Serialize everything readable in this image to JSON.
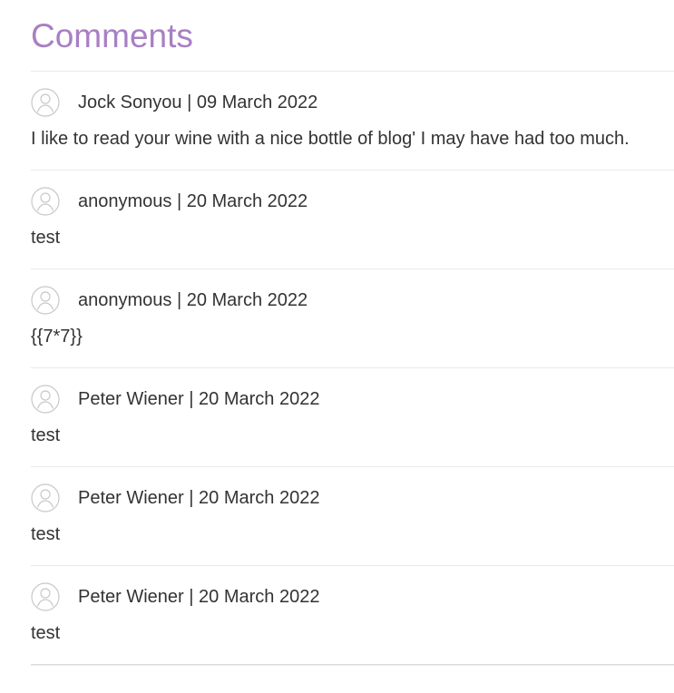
{
  "section": {
    "title": "Comments"
  },
  "comments": [
    {
      "author_line": "Jock Sonyou | 09 March 2022",
      "text": "I like to read your wine with a nice bottle of blog' I may have had too much.",
      "avatar_icon": "user-avatar-icon"
    },
    {
      "author_line": "anonymous | 20 March 2022",
      "text": "test",
      "avatar_icon": "user-avatar-icon"
    },
    {
      "author_line": "anonymous | 20 March 2022",
      "text": "{{7*7}}",
      "avatar_icon": "user-avatar-icon"
    },
    {
      "author_line": "Peter Wiener | 20 March 2022",
      "text": "test",
      "avatar_icon": "user-avatar-icon"
    },
    {
      "author_line": "Peter Wiener | 20 March 2022",
      "text": "test",
      "avatar_icon": "user-avatar-icon"
    },
    {
      "author_line": "Peter Wiener | 20 March 2022",
      "text": "test",
      "avatar_icon": "user-avatar-icon"
    }
  ],
  "colors": {
    "title": "#a87fc4",
    "text": "#333333",
    "divider": "#e9e9e9",
    "avatar_stroke": "#c8c8c8"
  }
}
